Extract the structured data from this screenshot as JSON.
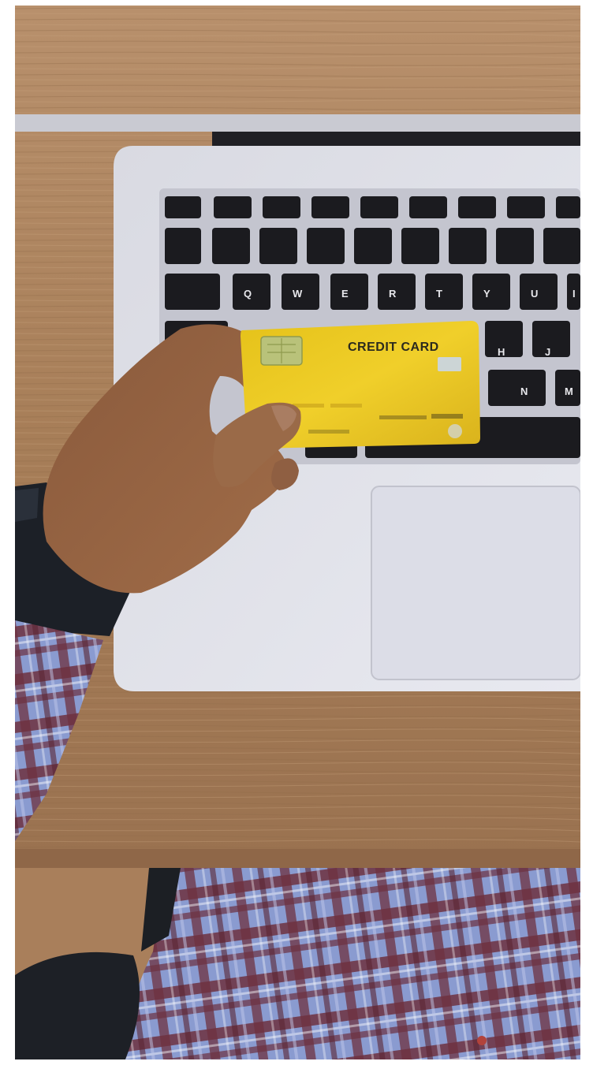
{
  "photo": {
    "card": {
      "title": "CREDIT CARD"
    },
    "keyboard": {
      "keys": [
        "Q",
        "W",
        "E",
        "R",
        "T",
        "Y",
        "U",
        "I",
        "H",
        "J",
        "N",
        "M"
      ]
    },
    "colors": {
      "desk": "#b58a63",
      "laptop": "#dcdde6",
      "card": "#e8c21f",
      "shirt_blue": "#7f93c8",
      "shirt_maroon": "#6d3140"
    }
  }
}
